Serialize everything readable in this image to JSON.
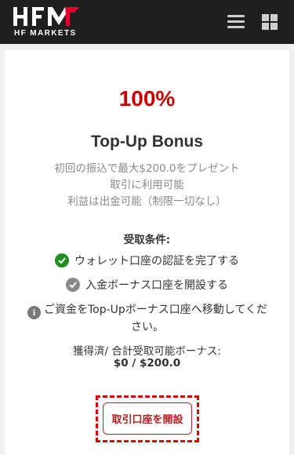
{
  "header": {
    "logo_text": "HFM",
    "logo_subtext": "HF MARKETS",
    "menu_icon": "hamburger-menu-icon",
    "apps_icon": "grid-apps-icon"
  },
  "bonus": {
    "percent": "100%",
    "title": "Top-Up Bonus",
    "description": [
      "初回の振込で最大$200.0をプレゼント",
      "取引に利用可能",
      "利益は出金可能（制限一切なし）"
    ],
    "conditions_label": "受取条件:",
    "conditions": [
      {
        "text": "ウォレット口座の認証を完了する",
        "status": "complete",
        "icon": "check-circle-icon",
        "color": "#1e8f1e"
      },
      {
        "text": "入金ボーナス口座を開設する",
        "status": "pending",
        "icon": "check-circle-icon",
        "color": "#8a8a8a"
      }
    ],
    "info_text": "ご資金をTop-Upボーナス口座へ移動してください。",
    "info_icon": "info-icon",
    "earned_label": "獲得済/ 合計受取可能ボーナス:",
    "earned_value": "$0 / $200.0",
    "cta_label": "取引口座を開設"
  },
  "colors": {
    "header_bg": "#1f1f1f",
    "accent_red": "#cc0000",
    "button_red": "#b22222",
    "check_green": "#1e8f1e"
  }
}
